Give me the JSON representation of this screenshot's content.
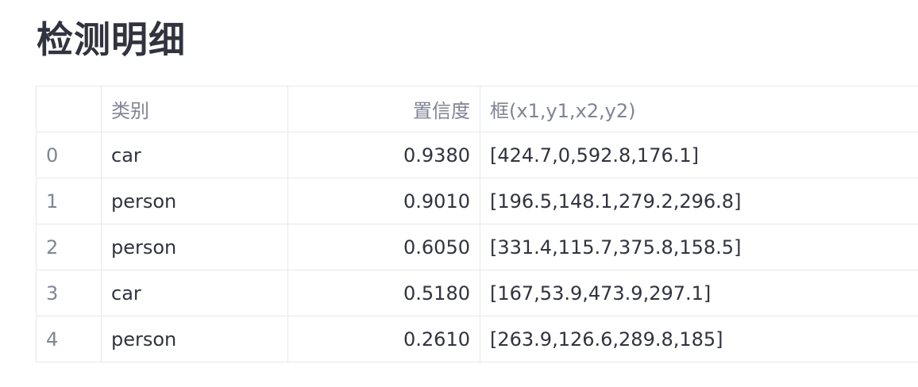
{
  "page": {
    "title": "检测明细"
  },
  "table": {
    "headers": {
      "index": "",
      "class": "类别",
      "confidence": "置信度",
      "box": "框(x1,y1,x2,y2)"
    },
    "rows": [
      {
        "index": "0",
        "class": "car",
        "confidence": "0.9380",
        "box": "[424.7,0,592.8,176.1]"
      },
      {
        "index": "1",
        "class": "person",
        "confidence": "0.9010",
        "box": "[196.5,148.1,279.2,296.8]"
      },
      {
        "index": "2",
        "class": "person",
        "confidence": "0.6050",
        "box": "[331.4,115.7,375.8,158.5]"
      },
      {
        "index": "3",
        "class": "car",
        "confidence": "0.5180",
        "box": "[167,53.9,473.9,297.1]"
      },
      {
        "index": "4",
        "class": "person",
        "confidence": "0.2610",
        "box": "[263.9,126.6,289.8,185]"
      }
    ]
  },
  "colors": {
    "text": "#31333f",
    "muted": "#808495",
    "border": "#e6e8ee",
    "background": "#ffffff"
  }
}
